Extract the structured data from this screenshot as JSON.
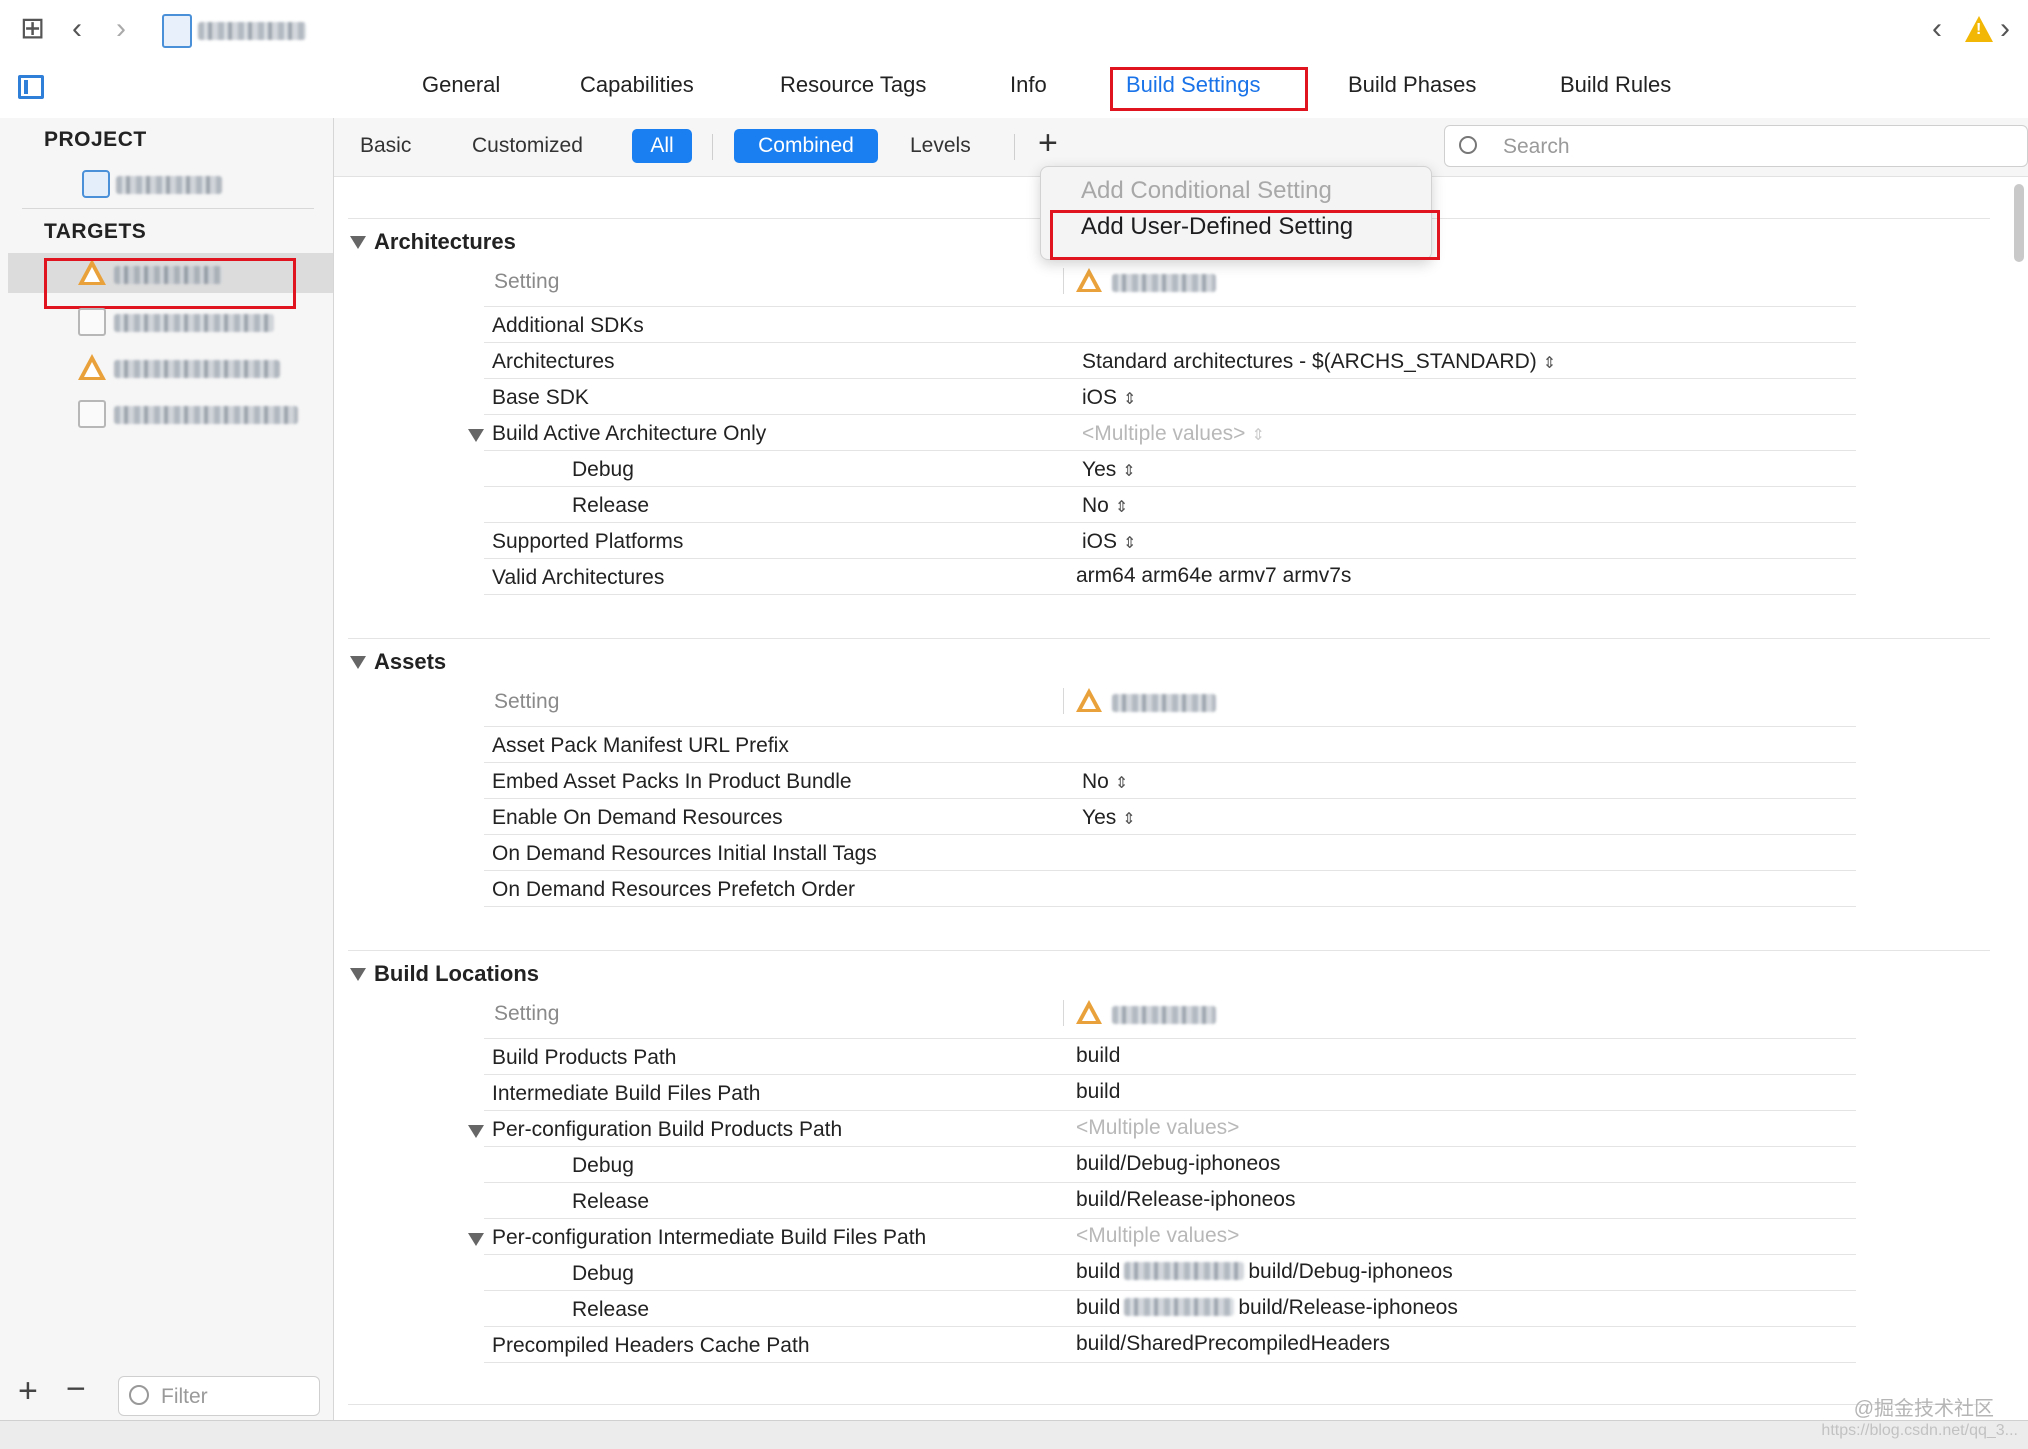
{
  "tabs": {
    "general": "General",
    "capabilities": "Capabilities",
    "resource_tags": "Resource Tags",
    "info": "Info",
    "build_settings": "Build Settings",
    "build_phases": "Build Phases",
    "build_rules": "Build Rules"
  },
  "navigator": {
    "project_header": "PROJECT",
    "targets_header": "TARGETS",
    "filter_placeholder": "Filter"
  },
  "filterbar": {
    "basic": "Basic",
    "customized": "Customized",
    "all": "All",
    "combined": "Combined",
    "levels": "Levels",
    "add": "+",
    "search_placeholder": "Search"
  },
  "popup_menu": {
    "add_conditional": "Add Conditional Setting",
    "add_user_defined": "Add User-Defined Setting"
  },
  "sections": {
    "architectures": {
      "title": "Architectures",
      "setting_header": "Setting",
      "rows": [
        {
          "label": "Additional SDKs",
          "value": ""
        },
        {
          "label": "Architectures",
          "value": "Standard architectures  -  $(ARCHS_STANDARD)"
        },
        {
          "label": "Base SDK",
          "value": "iOS"
        },
        {
          "label": "Build Active Architecture Only",
          "value": "<Multiple values>"
        },
        {
          "label": "Debug",
          "value": "Yes"
        },
        {
          "label": "Release",
          "value": "No"
        },
        {
          "label": "Supported Platforms",
          "value": "iOS"
        },
        {
          "label": "Valid Architectures",
          "value": "arm64 arm64e armv7 armv7s"
        }
      ]
    },
    "assets": {
      "title": "Assets",
      "setting_header": "Setting",
      "rows": [
        {
          "label": "Asset Pack Manifest URL Prefix",
          "value": ""
        },
        {
          "label": "Embed Asset Packs In Product Bundle",
          "value": "No"
        },
        {
          "label": "Enable On Demand Resources",
          "value": "Yes"
        },
        {
          "label": "On Demand Resources Initial Install Tags",
          "value": ""
        },
        {
          "label": "On Demand Resources Prefetch Order",
          "value": ""
        }
      ]
    },
    "build_locations": {
      "title": "Build Locations",
      "setting_header": "Setting",
      "rows": [
        {
          "label": "Build Products Path",
          "value": "build"
        },
        {
          "label": "Intermediate Build Files Path",
          "value": "build"
        },
        {
          "label": "Per-configuration Build Products Path",
          "value": "<Multiple values>"
        },
        {
          "label": "Debug",
          "value": "build/Debug-iphoneos"
        },
        {
          "label": "Release",
          "value": "build/Release-iphoneos"
        },
        {
          "label": "Per-configuration Intermediate Build Files Path",
          "value": "<Multiple values>"
        },
        {
          "label": "Debug",
          "value_a": "build",
          "value_b": "build/Debug-iphoneos"
        },
        {
          "label": "Release",
          "value_a": "build",
          "value_b": "build/Release-iphoneos"
        },
        {
          "label": "Precompiled Headers Cache Path",
          "value": "build/SharedPrecompiledHeaders"
        }
      ]
    }
  },
  "watermark": "@掘金技术社区",
  "watermark_url": "https://blog.csdn.net/qq_3...",
  "colors": {
    "accent": "#1a7ff0",
    "highlight_box": "#e0141e",
    "warning": "#f2b705"
  }
}
